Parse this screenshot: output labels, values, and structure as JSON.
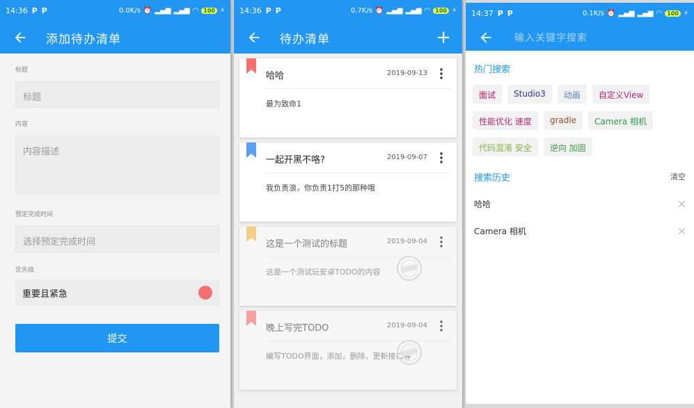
{
  "screen_add": {
    "status": {
      "time": "14:36",
      "p1": "P",
      "p2": "P",
      "speed": "0.0K/s",
      "battery": "100"
    },
    "title": "添加待办清单",
    "title_label": "标题",
    "title_placeholder": "标题",
    "content_label": "内容",
    "content_placeholder": "内容描述",
    "time_label": "预定完成时间",
    "time_placeholder": "选择预定完成时间",
    "priority_label": "优先级",
    "priority_value": "重要且紧急",
    "priority_color": "#f46f6f",
    "submit_label": "提交"
  },
  "screen_list": {
    "status": {
      "time": "14:36",
      "p1": "P",
      "p2": "P",
      "speed": "0.7K/s",
      "battery": "100"
    },
    "title": "待办清单",
    "add_icon": "+",
    "items": [
      {
        "title": "哈哈",
        "date": "2019-09-13",
        "desc": "最为致命1",
        "bookmark_color": "#f46f6f",
        "done": false
      },
      {
        "title": "一起开黑不咯?",
        "date": "2019-09-07",
        "desc": "我负责浪，你负责1打5的那种哦",
        "bookmark_color": "#5aa0f0",
        "done": false
      },
      {
        "title": "这是一个测试的标题",
        "date": "2019-09-04",
        "desc": "这是一个测试玩安卓TODO的内容",
        "bookmark_color": "#f2cf86",
        "done": true
      },
      {
        "title": "晚上写完TODO",
        "date": "2019-09-04",
        "desc": "编写TODO界面，添加，删除，更新接口等",
        "bookmark_color": "#f7a0a0",
        "done": true
      }
    ]
  },
  "screen_search": {
    "status": {
      "time": "14:37",
      "p1": "P",
      "p2": "P",
      "speed": "0.1K/s",
      "battery": "100"
    },
    "placeholder": "输入关键字搜索",
    "hot_title": "热门搜索",
    "hot_tags": [
      {
        "text": "面试",
        "color": "#c2185b"
      },
      {
        "text": "Studio3",
        "color": "#283593"
      },
      {
        "text": "动画",
        "color": "#5c85b8"
      },
      {
        "text": "自定义View",
        "color": "#b8287a"
      },
      {
        "text": "性能优化 速度",
        "color": "#b8287a"
      },
      {
        "text": "gradle",
        "color": "#a0491f"
      },
      {
        "text": "Camera 相机",
        "color": "#2e9a4d"
      },
      {
        "text": "代码混淆 安全",
        "color": "#7cb342"
      },
      {
        "text": "逆向 加固",
        "color": "#3a9a3f"
      }
    ],
    "history_title": "搜索历史",
    "clear_label": "清空",
    "history": [
      "哈哈",
      "Camera 相机"
    ]
  }
}
